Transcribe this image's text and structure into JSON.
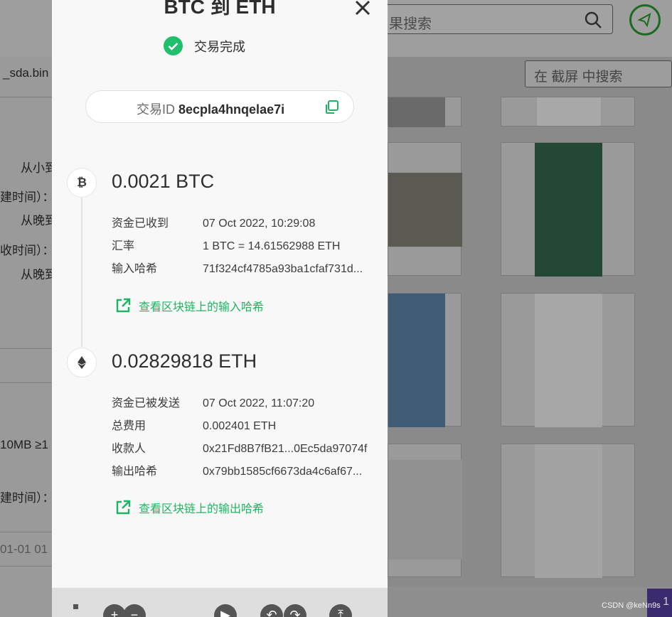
{
  "background": {
    "search_placeholder": "果搜索",
    "screenshot_search_placeholder": "在 截屏 中搜索",
    "left_texts": [
      "_sda.bin",
      "从小到",
      "建时间）：",
      "从晚到",
      "收时间）：",
      "从晚到",
      "10MB ≥1",
      "建时间）：",
      "01-01 01"
    ],
    "watermark": "CSDN @keNn9s",
    "corner_button": "1"
  },
  "modal": {
    "title": "BTC 到 ETH",
    "status": "交易完成",
    "tx_label": "交易ID",
    "tx_id": "8ecpla4hnqelae7i",
    "input": {
      "coin_symbol": "₿",
      "amount": "0.0021 BTC",
      "rows": [
        {
          "key": "资金已收到",
          "value": "07 Oct 2022, 10:29:08"
        },
        {
          "key": "汇率",
          "value": "1 BTC = 14.61562988 ETH"
        },
        {
          "key": "输入哈希",
          "value": "71f324cf4785a93ba1cfaf731d..."
        }
      ],
      "link": "查看区块链上的输入哈希"
    },
    "output": {
      "amount": "0.02829818 ETH",
      "rows": [
        {
          "key": "资金已被发送",
          "value": "07 Oct 2022, 11:07:20"
        },
        {
          "key": "总费用",
          "value": "0.002401 ETH"
        },
        {
          "key": "收款人",
          "value": "0x21Fd8B7fB21...0Ec5da97074f"
        },
        {
          "key": "输出哈希",
          "value": "0x79bb1585cf6673da4c6af67..."
        }
      ],
      "link": "查看区块链上的输出哈希"
    }
  },
  "colors": {
    "accent_green": "#1fb464",
    "check_green": "#20bf6b"
  }
}
